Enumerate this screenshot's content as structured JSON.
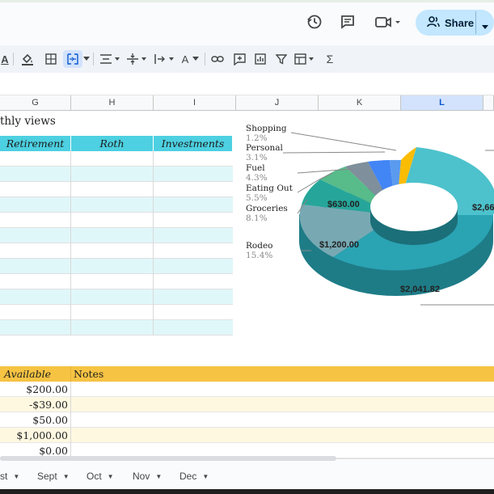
{
  "header": {
    "share_label": "Share",
    "icons": [
      "history-icon",
      "comment-icon",
      "video-call-icon",
      "share-people-icon"
    ]
  },
  "toolbar": {
    "font_color_glyph": "A",
    "text_color_glyph": "A",
    "functions_glyph": "Σ"
  },
  "columns": {
    "g": "G",
    "h": "H",
    "i": "I",
    "j": "J",
    "k": "K",
    "l": "L"
  },
  "sheet": {
    "title_partial": "thly views",
    "table_headers": [
      "Retirement",
      "Roth",
      "Investments"
    ],
    "bottom_headers": {
      "available": "Available",
      "notes": "Notes"
    },
    "available_values": [
      "$200.00",
      "-$39.00",
      "$50.00",
      "$1,000.00",
      "$0.00"
    ]
  },
  "chart_data": {
    "type": "pie",
    "style": "3d-donut",
    "legend_placement": "callouts-left",
    "slices": [
      {
        "label": "Shopping",
        "percent": "1.2%",
        "color": "#ea4335"
      },
      {
        "label": "Personal",
        "percent": "3.1%",
        "color": "#4285f4"
      },
      {
        "label": "Fuel",
        "percent": "4.3%",
        "color": "#7fb3e8"
      },
      {
        "label": "Eating Out",
        "percent": "5.5%",
        "color": "#57bb8a"
      },
      {
        "label": "Groceries",
        "percent": "8.1%",
        "color": "#26a69a",
        "value": "$630.00"
      },
      {
        "label": "Rodeo",
        "percent": "15.4%",
        "color": "#78a9b3",
        "value": "$1,200.00"
      },
      {
        "label": "",
        "percent": "",
        "color": "#2aa3b3",
        "value": "$2,041.82"
      },
      {
        "label": "",
        "percent": "",
        "color": "#4dc2cc",
        "value": "$2,66"
      },
      {
        "label": "",
        "percent": "",
        "color": "#fbbc04"
      }
    ]
  },
  "tabs": [
    {
      "label": "st"
    },
    {
      "label": "Sept"
    },
    {
      "label": "Oct"
    },
    {
      "label": "Nov"
    },
    {
      "label": "Dec"
    }
  ]
}
